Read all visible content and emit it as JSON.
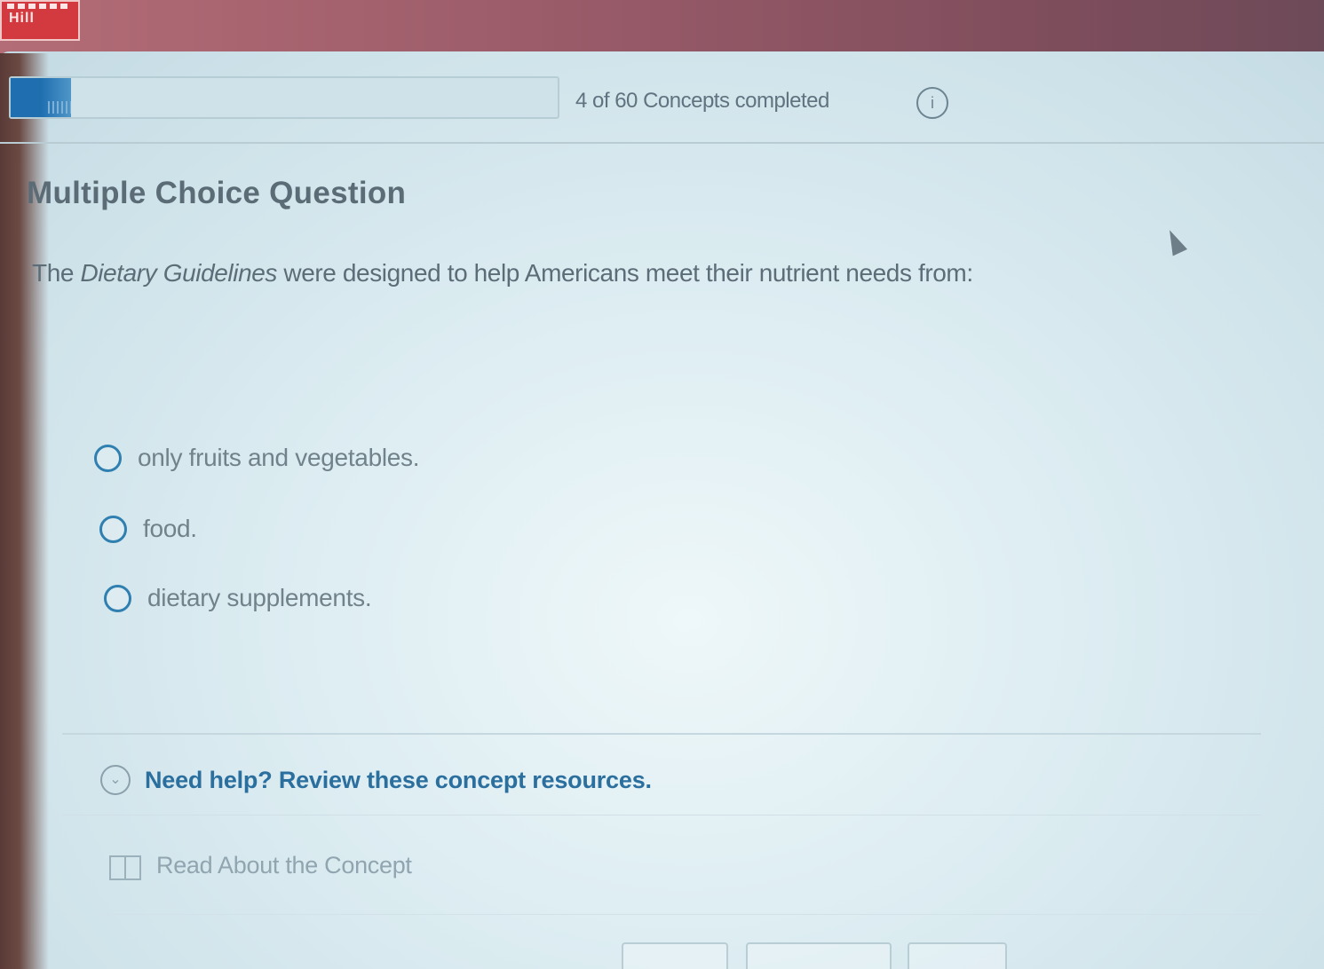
{
  "header": {
    "logo_text": "Hill",
    "progress": {
      "completed": 4,
      "total": 60,
      "text": "4 of 60 Concepts completed"
    },
    "info_icon": "i"
  },
  "question": {
    "type_label": "Multiple Choice Question",
    "text_prefix": "The ",
    "text_italic": "Dietary Guidelines",
    "text_suffix": " were designed to help Americans meet their nutrient needs from:",
    "options": [
      {
        "label": "only fruits and vegetables."
      },
      {
        "label": "food."
      },
      {
        "label": "dietary supplements."
      }
    ]
  },
  "help": {
    "toggle_icon": "⌄",
    "link_label": "Need help? Review these concept resources.",
    "resource_label": "Read About the Concept"
  },
  "colors": {
    "accent": "#2a6f9e",
    "progress_fill": "#1f6fb0",
    "radio": "#2f7fb0"
  }
}
